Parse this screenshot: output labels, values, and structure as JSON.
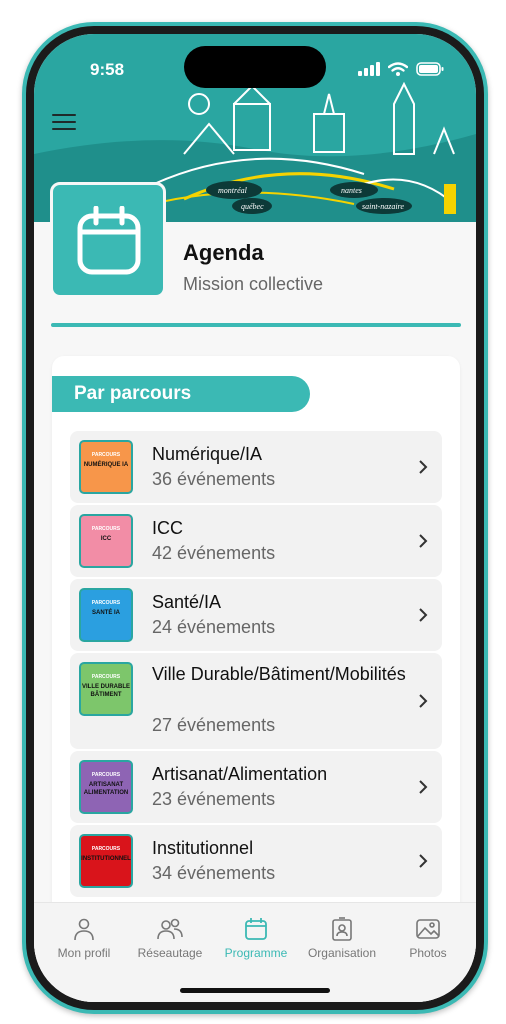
{
  "status": {
    "time": "9:58"
  },
  "header": {
    "title": "Agenda",
    "subtitle": "Mission collective"
  },
  "section": {
    "label": "Par parcours"
  },
  "tracks": [
    {
      "title": "Numérique/IA",
      "count": "36 événements",
      "thumb_top": "PARCOURS",
      "thumb_main": "NUMÉRIQUE IA",
      "color": "#f7964a"
    },
    {
      "title": "ICC",
      "count": "42 événements",
      "thumb_top": "PARCOURS",
      "thumb_main": "ICC",
      "color": "#f28da6"
    },
    {
      "title": "Santé/IA",
      "count": "24 événements",
      "thumb_top": "PARCOURS",
      "thumb_main": "SANTÉ IA",
      "color": "#2b9fe0"
    },
    {
      "title": "Ville Durable/Bâtiment/Mobilités",
      "count": "27 événements",
      "thumb_top": "PARCOURS",
      "thumb_main": "VILLE DURABLE BÂTIMENT",
      "color": "#7dc66b"
    },
    {
      "title": "Artisanat/Alimentation",
      "count": "23 événements",
      "thumb_top": "PARCOURS",
      "thumb_main": "ARTISANAT ALIMENTATION",
      "color": "#8e64b4"
    },
    {
      "title": "Institutionnel",
      "count": "34 événements",
      "thumb_top": "PARCOURS",
      "thumb_main": "INSTITUTIONNEL",
      "color": "#d9141b"
    }
  ],
  "tabs": [
    {
      "label": "Mon profil",
      "icon": "person-icon"
    },
    {
      "label": "Réseautage",
      "icon": "people-icon"
    },
    {
      "label": "Programme",
      "icon": "calendar-icon"
    },
    {
      "label": "Organisation",
      "icon": "id-badge-icon"
    },
    {
      "label": "Photos",
      "icon": "photo-icon"
    }
  ],
  "banner": {
    "cities": [
      "montréal",
      "québec",
      "nantes",
      "saint-nazaire"
    ]
  },
  "colors": {
    "accent": "#3bb9b4",
    "banner": "#2aa6a1"
  }
}
